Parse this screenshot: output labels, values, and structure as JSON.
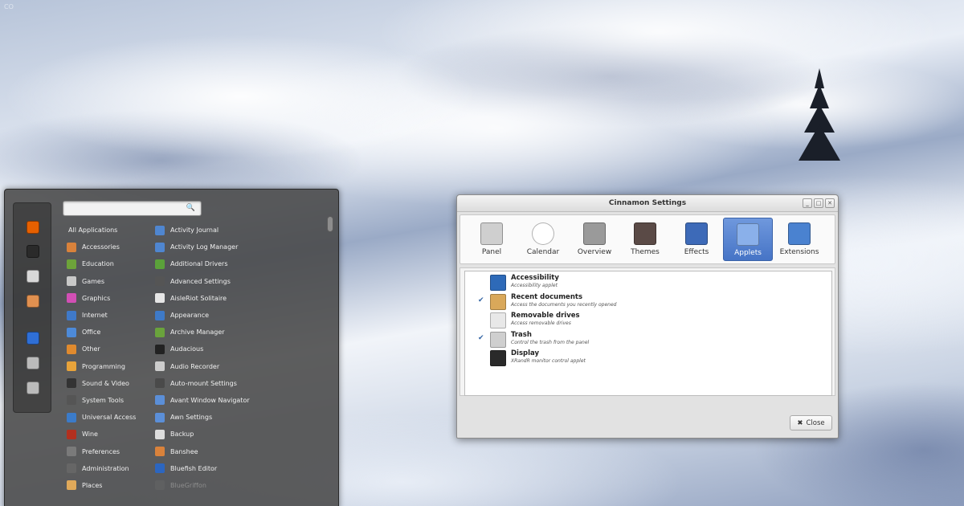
{
  "desktop": {
    "corner_label": "CO"
  },
  "menu": {
    "favorites": [
      {
        "icon": "firefox-icon",
        "color": "#e66000"
      },
      {
        "icon": "terminal-icon",
        "color": "#2a2a2a"
      },
      {
        "icon": "files-icon",
        "color": "#d8d8d8"
      },
      {
        "icon": "eye-icon",
        "color": "#e09050"
      },
      {
        "icon": "computer-icon",
        "color": "#2f6fd6"
      },
      {
        "icon": "logout-icon",
        "color": "#bbbbbb"
      },
      {
        "icon": "power-icon",
        "color": "#bbbbbb"
      }
    ],
    "search": {
      "value": "",
      "placeholder": ""
    },
    "categories": [
      {
        "label": "All Applications",
        "color": ""
      },
      {
        "label": "Accessories",
        "color": "#d9823b"
      },
      {
        "label": "Education",
        "color": "#6da33a"
      },
      {
        "label": "Games",
        "color": "#c8c8c8"
      },
      {
        "label": "Graphics",
        "color": "#d24fb5"
      },
      {
        "label": "Internet",
        "color": "#3f79c9"
      },
      {
        "label": "Office",
        "color": "#4d8ad8"
      },
      {
        "label": "Other",
        "color": "#e08a2e"
      },
      {
        "label": "Programming",
        "color": "#e8a33a"
      },
      {
        "label": "Sound & Video",
        "color": "#333333"
      },
      {
        "label": "System Tools",
        "color": "#555555"
      },
      {
        "label": "Universal Access",
        "color": "#3b7bc9"
      },
      {
        "label": "Wine",
        "color": "#b2301f"
      },
      {
        "label": "Preferences",
        "color": "#7a7a7a"
      },
      {
        "label": "Administration",
        "color": "#666666"
      },
      {
        "label": "Places",
        "color": "#e0a95a"
      }
    ],
    "apps": [
      {
        "label": "Activity Journal",
        "color": "#4f86d0",
        "dim": false
      },
      {
        "label": "Activity Log Manager",
        "color": "#4f86d0",
        "dim": false
      },
      {
        "label": "Additional Drivers",
        "color": "#5ba23a",
        "dim": false
      },
      {
        "label": "Advanced Settings",
        "color": "#555555",
        "dim": false
      },
      {
        "label": "AisleRiot Solitaire",
        "color": "#e6e6e6",
        "dim": false
      },
      {
        "label": "Appearance",
        "color": "#3e7ac8",
        "dim": false
      },
      {
        "label": "Archive Manager",
        "color": "#6aa33c",
        "dim": false
      },
      {
        "label": "Audacious",
        "color": "#222222",
        "dim": false
      },
      {
        "label": "Audio Recorder",
        "color": "#cccccc",
        "dim": false
      },
      {
        "label": "Auto-mount Settings",
        "color": "#4a4a4a",
        "dim": false
      },
      {
        "label": "Avant Window Navigator",
        "color": "#5b8fd8",
        "dim": false
      },
      {
        "label": "Awn Settings",
        "color": "#5b8fd8",
        "dim": false
      },
      {
        "label": "Backup",
        "color": "#dddddd",
        "dim": false
      },
      {
        "label": "Banshee",
        "color": "#d9823b",
        "dim": false
      },
      {
        "label": "Bluefish Editor",
        "color": "#2c66c0",
        "dim": false
      },
      {
        "label": "BlueGriffon",
        "color": "#6a6a6a",
        "dim": true
      }
    ]
  },
  "settings": {
    "title": "Cinnamon Settings",
    "window_buttons": [
      "_",
      "□",
      "✕"
    ],
    "tools": [
      {
        "label": "Panel",
        "icon": "panel-icon",
        "color": "#cfcfcf",
        "active": false
      },
      {
        "label": "Calendar",
        "icon": "clock-icon",
        "color": "#ffffff",
        "active": false
      },
      {
        "label": "Overview",
        "icon": "overview-icon",
        "color": "#9a9a9a",
        "active": false
      },
      {
        "label": "Themes",
        "icon": "themes-icon",
        "color": "#5a4a46",
        "active": false
      },
      {
        "label": "Effects",
        "icon": "effects-icon",
        "color": "#3d6ab8",
        "active": false
      },
      {
        "label": "Applets",
        "icon": "applets-icon",
        "color": "#8ab0ea",
        "active": true
      },
      {
        "label": "Extensions",
        "icon": "extensions-icon",
        "color": "#4a82d0",
        "active": false
      }
    ],
    "applets": [
      {
        "name": "Accessibility",
        "desc": "Accessibility applet",
        "checked": false,
        "icon": "accessibility-icon",
        "color": "#2e6ab8"
      },
      {
        "name": "Recent documents",
        "desc": "Access the documents you recently opened",
        "checked": true,
        "icon": "recent-documents-icon",
        "color": "#d9a85a"
      },
      {
        "name": "Removable drives",
        "desc": "Access removable drives",
        "checked": false,
        "icon": "eject-icon",
        "color": "#e8e8e8"
      },
      {
        "name": "Trash",
        "desc": "Control the trash from the panel",
        "checked": true,
        "icon": "trash-icon",
        "color": "#cfcfcf"
      },
      {
        "name": "Display",
        "desc": "XRandR monitor control applet",
        "checked": false,
        "icon": "display-icon",
        "color": "#2a2a2a"
      }
    ],
    "close_label": "Close",
    "check_glyph": "✔"
  }
}
